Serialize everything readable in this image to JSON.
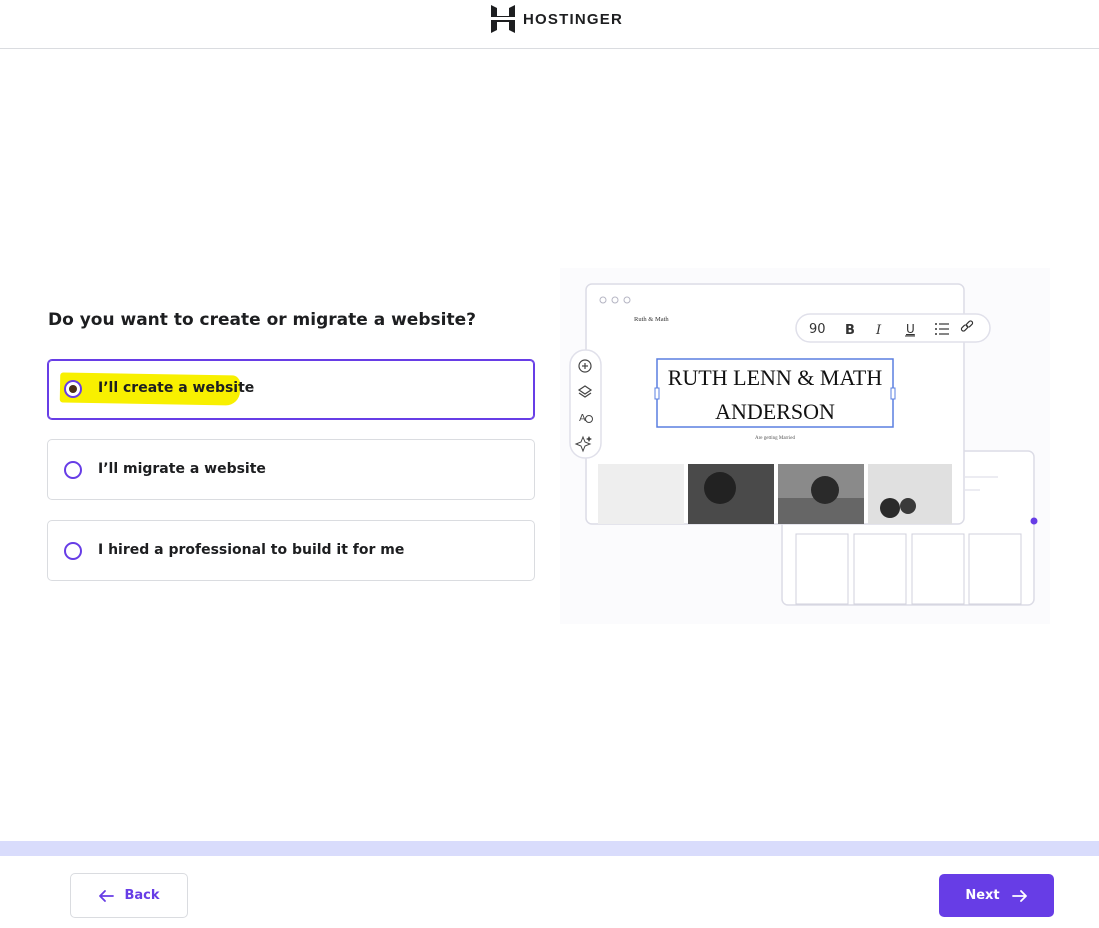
{
  "brand": {
    "name": "HOSTINGER"
  },
  "question": "Do you want to create or migrate a website?",
  "options": [
    {
      "label": "I’ll create a website",
      "selected": true
    },
    {
      "label": "I’ll migrate a website",
      "selected": false
    },
    {
      "label": "I hired a professional to build it for me",
      "selected": false
    }
  ],
  "preview": {
    "site_name": "Ruth & Math",
    "headline_line1": "RUTH LENN & MATH",
    "headline_line2": "ANDERSON",
    "tagline": "Are getting Married",
    "toolbar": {
      "font_size": "90",
      "bold": "B",
      "italic": "I",
      "underline": "U"
    }
  },
  "footer": {
    "back_label": "Back",
    "next_label": "Next"
  },
  "colors": {
    "accent": "#673de6",
    "highlight": "#f8f000",
    "footer_band": "#d9dcfc"
  }
}
